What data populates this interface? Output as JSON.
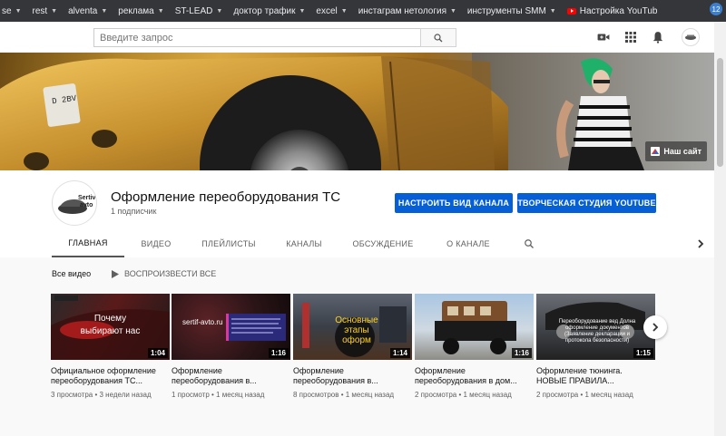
{
  "bookmarks": [
    {
      "label": "se",
      "icon": "folder-icon"
    },
    {
      "label": "rest",
      "icon": "folder-icon"
    },
    {
      "label": "alventa",
      "icon": "folder-icon"
    },
    {
      "label": "реклама",
      "icon": "folder-icon"
    },
    {
      "label": "ST-LEAD",
      "icon": "folder-icon"
    },
    {
      "label": "доктор трафик",
      "icon": "folder-icon"
    },
    {
      "label": "excel",
      "icon": "folder-icon"
    },
    {
      "label": "инстаграм нетология",
      "icon": "folder-icon"
    },
    {
      "label": "инструменты SMM",
      "icon": "folder-icon"
    },
    {
      "label": "Настройка YouTub",
      "icon": "youtube-icon"
    }
  ],
  "extension_badge": "12",
  "masthead": {
    "search_placeholder": "Введите запрос"
  },
  "banner": {
    "site_link_label": "Наш сайт"
  },
  "channel": {
    "logo_text_line1": "Sertiv",
    "logo_text_line2": "avto",
    "title": "Оформление переоборудования ТС",
    "subscribers": "1 подписчик",
    "customize_button": "НАСТРОИТЬ ВИД КАНАЛА",
    "studio_button": "ТВОРЧЕСКАЯ СТУДИЯ YOUTUBE",
    "tabs": [
      "ГЛАВНАЯ",
      "ВИДЕО",
      "ПЛЕЙЛИСТЫ",
      "КАНАЛЫ",
      "ОБСУЖДЕНИЕ",
      "О КАНАЛЕ"
    ],
    "active_tab": "ГЛАВНАЯ"
  },
  "section": {
    "title": "Все видео",
    "play_all": "ВОСПРОИЗВЕСТИ ВСЕ"
  },
  "videos": [
    {
      "title_line1": "Официальное оформление",
      "title_line2": "переоборудования ТС...",
      "meta": "3 просмотра • 3 недели назад",
      "duration": "1:04",
      "overlay_line1": "Почему",
      "overlay_line2": "выбирают нас"
    },
    {
      "title_line1": "Оформление",
      "title_line2": "переоборудования в...",
      "meta": "1 просмотр • 1 месяц назад",
      "duration": "1:16",
      "overlay_line1": "sertif-avto.ru",
      "overlay_line2": ""
    },
    {
      "title_line1": "Оформление",
      "title_line2": "переоборудования в...",
      "meta": "8 просмотров • 1 месяц назад",
      "duration": "1:14",
      "overlay_line1": "Основные",
      "overlay_line2": "этапы",
      "overlay_line3": "оформ"
    },
    {
      "title_line1": "Оформление",
      "title_line2": "переоборудования в дом...",
      "meta": "2 просмотра • 1 месяц назад",
      "duration": "1:16",
      "overlay_line1": "",
      "overlay_line2": ""
    },
    {
      "title_line1": "Оформление тюнинга.",
      "title_line2": "НОВЫЕ ПРАВИЛА...",
      "meta": "2 просмотра • 1 месяц назад",
      "duration": "1:15",
      "overlay_line1": "Переоборудование вед Долна",
      "overlay_line2": "оформление документов",
      "overlay_line3": "(Заявление декларации и",
      "overlay_line4": "протокола безопасности)"
    }
  ],
  "colors": {
    "accent_blue": "#065fd4",
    "youtube_red": "#ff0000",
    "bookmark_bar": "#35363a"
  }
}
